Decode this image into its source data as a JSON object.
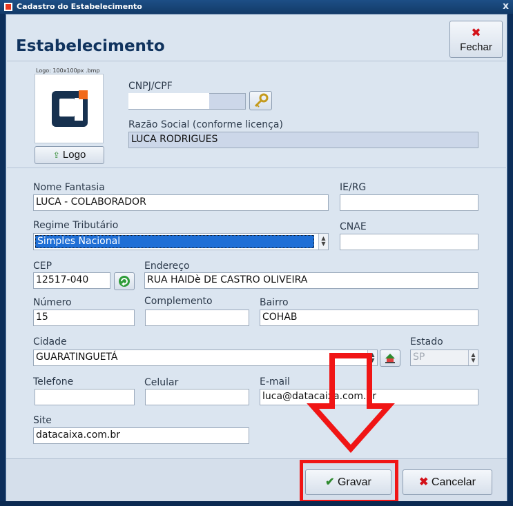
{
  "window": {
    "title": "Cadastro do Estabelecimento",
    "close_glyph": "x"
  },
  "header": {
    "title": "Estabelecimento",
    "close_button_label": "Fechar"
  },
  "logo": {
    "caption": "Logo: 100x100px .bmp",
    "button_label": "Logo"
  },
  "fields": {
    "cnpj_cpf": {
      "label": "CNPJ/CPF",
      "value": ""
    },
    "razao_social": {
      "label": "Razão Social (conforme licença)",
      "value": "LUCA RODRIGUES"
    },
    "nome_fantasia": {
      "label": "Nome Fantasia",
      "value": "LUCA - COLABORADOR"
    },
    "ie_rg": {
      "label": "IE/RG",
      "value": ""
    },
    "regime_tributario": {
      "label": "Regime Tributário",
      "value": "Simples Nacional"
    },
    "cnae": {
      "label": "CNAE",
      "value": ""
    },
    "cep": {
      "label": "CEP",
      "value": "12517-040"
    },
    "endereco": {
      "label": "Endereço",
      "value": "RUA HAIDè DE CASTRO OLIVEIRA"
    },
    "numero": {
      "label": "Número",
      "value": "15"
    },
    "complemento": {
      "label": "Complemento",
      "value": ""
    },
    "bairro": {
      "label": "Bairro",
      "value": "COHAB"
    },
    "cidade": {
      "label": "Cidade",
      "value": "GUARATINGUETÁ"
    },
    "estado": {
      "label": "Estado",
      "value": "SP"
    },
    "telefone": {
      "label": "Telefone",
      "value": ""
    },
    "celular": {
      "label": "Celular",
      "value": ""
    },
    "email": {
      "label": "E-mail",
      "value": "luca@datacaixa.com.br"
    },
    "site": {
      "label": "Site",
      "value": "datacaixa.com.br"
    }
  },
  "footer": {
    "save_label": "Gravar",
    "cancel_label": "Cancelar"
  },
  "colors": {
    "highlight": "#f01515",
    "brand_navy": "#10335e",
    "logo_orange": "#f26a1b"
  }
}
